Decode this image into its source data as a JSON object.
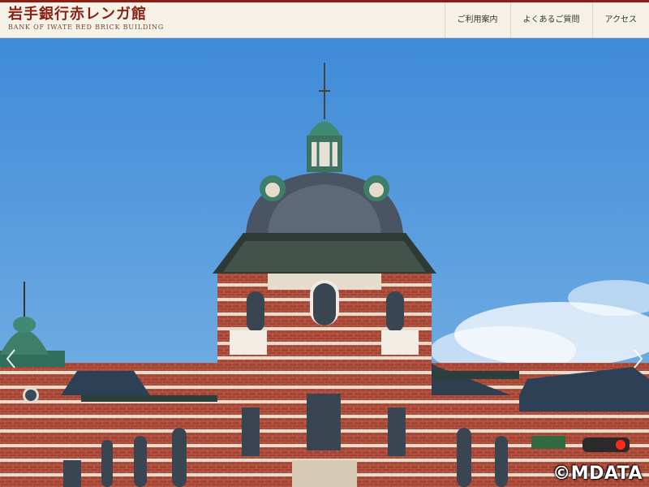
{
  "header": {
    "logo_jp": "岩手銀行赤レンガ館",
    "logo_en": "BANK OF IWATE RED BRICK BUILDING"
  },
  "nav": {
    "items": [
      {
        "label": "ご利用案内"
      },
      {
        "label": "よくあるご質問"
      },
      {
        "label": "アクセス"
      }
    ]
  },
  "hero": {
    "watermark": "©MDATA",
    "arrow_left_icon": "chevron-left-icon",
    "arrow_right_icon": "chevron-right-icon"
  },
  "colors": {
    "brand_red": "#8a1f14",
    "header_bg": "#f6f2e7",
    "sky": "#4d97dd",
    "brick": "#a8412f",
    "copper": "#3f7f69"
  }
}
